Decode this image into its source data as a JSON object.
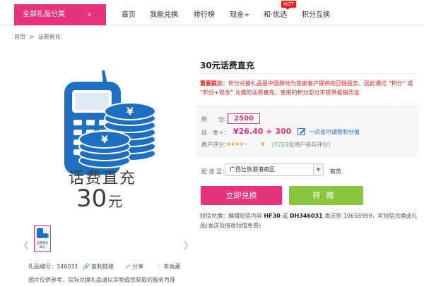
{
  "nav": {
    "category_button": "全部礼品分类",
    "items": [
      "首页",
      "我能兑换",
      "排行榜",
      "现金+",
      "和·优选",
      "积分互换"
    ],
    "hot_badge": "HOT"
  },
  "breadcrumb": {
    "home": "首页",
    "sep": ">",
    "current": "话费直充"
  },
  "product_image": {
    "title": "话费直充",
    "amount": "30",
    "unit": "元"
  },
  "thumbnail": {
    "caption_line1": "话费直充",
    "caption_line2": "30元"
  },
  "meta": {
    "gift_id_label": "礼品编号：",
    "gift_id": "346031",
    "copy_link": "复制链接",
    "share": "分享",
    "favorite": "未收藏",
    "note": "图片仅供参考，实际兑换礼品请以实物或您获取的服务为准"
  },
  "info": {
    "title": "30元话费直充",
    "notice_prefix": "重要提示：",
    "notice_body": "积分兑换礼品是中国移动为答谢客户提供的回馈服务，因此通过 “积分” 或 “积分+现金” 兑换的话费直充，使用的积分部分不提供报销凭证",
    "points_label": "积　　分：",
    "points_value": "2500",
    "cash_label": "现　金＋：",
    "cash_value": "¥26.40 + 300",
    "edit_hint": "一点击可调整积分值",
    "rating_label": "用户评分：",
    "rating_score": 4.5,
    "rating_count": "7223",
    "rating_suffix": "位用户参与评分）",
    "rating_prefix": "（"
  },
  "shipping": {
    "label": "配 送 至：",
    "region": "广西壮族港港南区",
    "stock": "有货"
  },
  "buttons": {
    "buy": "立即兑换",
    "gift": "转赠"
  },
  "sms": {
    "prefix": "短信兑换：编辑短信内容 ",
    "code1": "HF30",
    "or": " 或 ",
    "code2": "DH346031",
    "mid": " 发送到 10658999，可短信兑换此礼品(发送及接收短信免费)"
  },
  "colors": {
    "brand": "#e7327c",
    "green": "#8cc63f",
    "notice": "#e2231a",
    "icon_blue": "#1e6fc1"
  },
  "icons": [
    "chevron-down-icon",
    "phone-icon",
    "coin-stack-icon",
    "edit-icon",
    "copy-link-icon",
    "share-icon",
    "heart-icon",
    "dropdown-icon",
    "arrow-left-icon",
    "arrow-right-icon"
  ]
}
